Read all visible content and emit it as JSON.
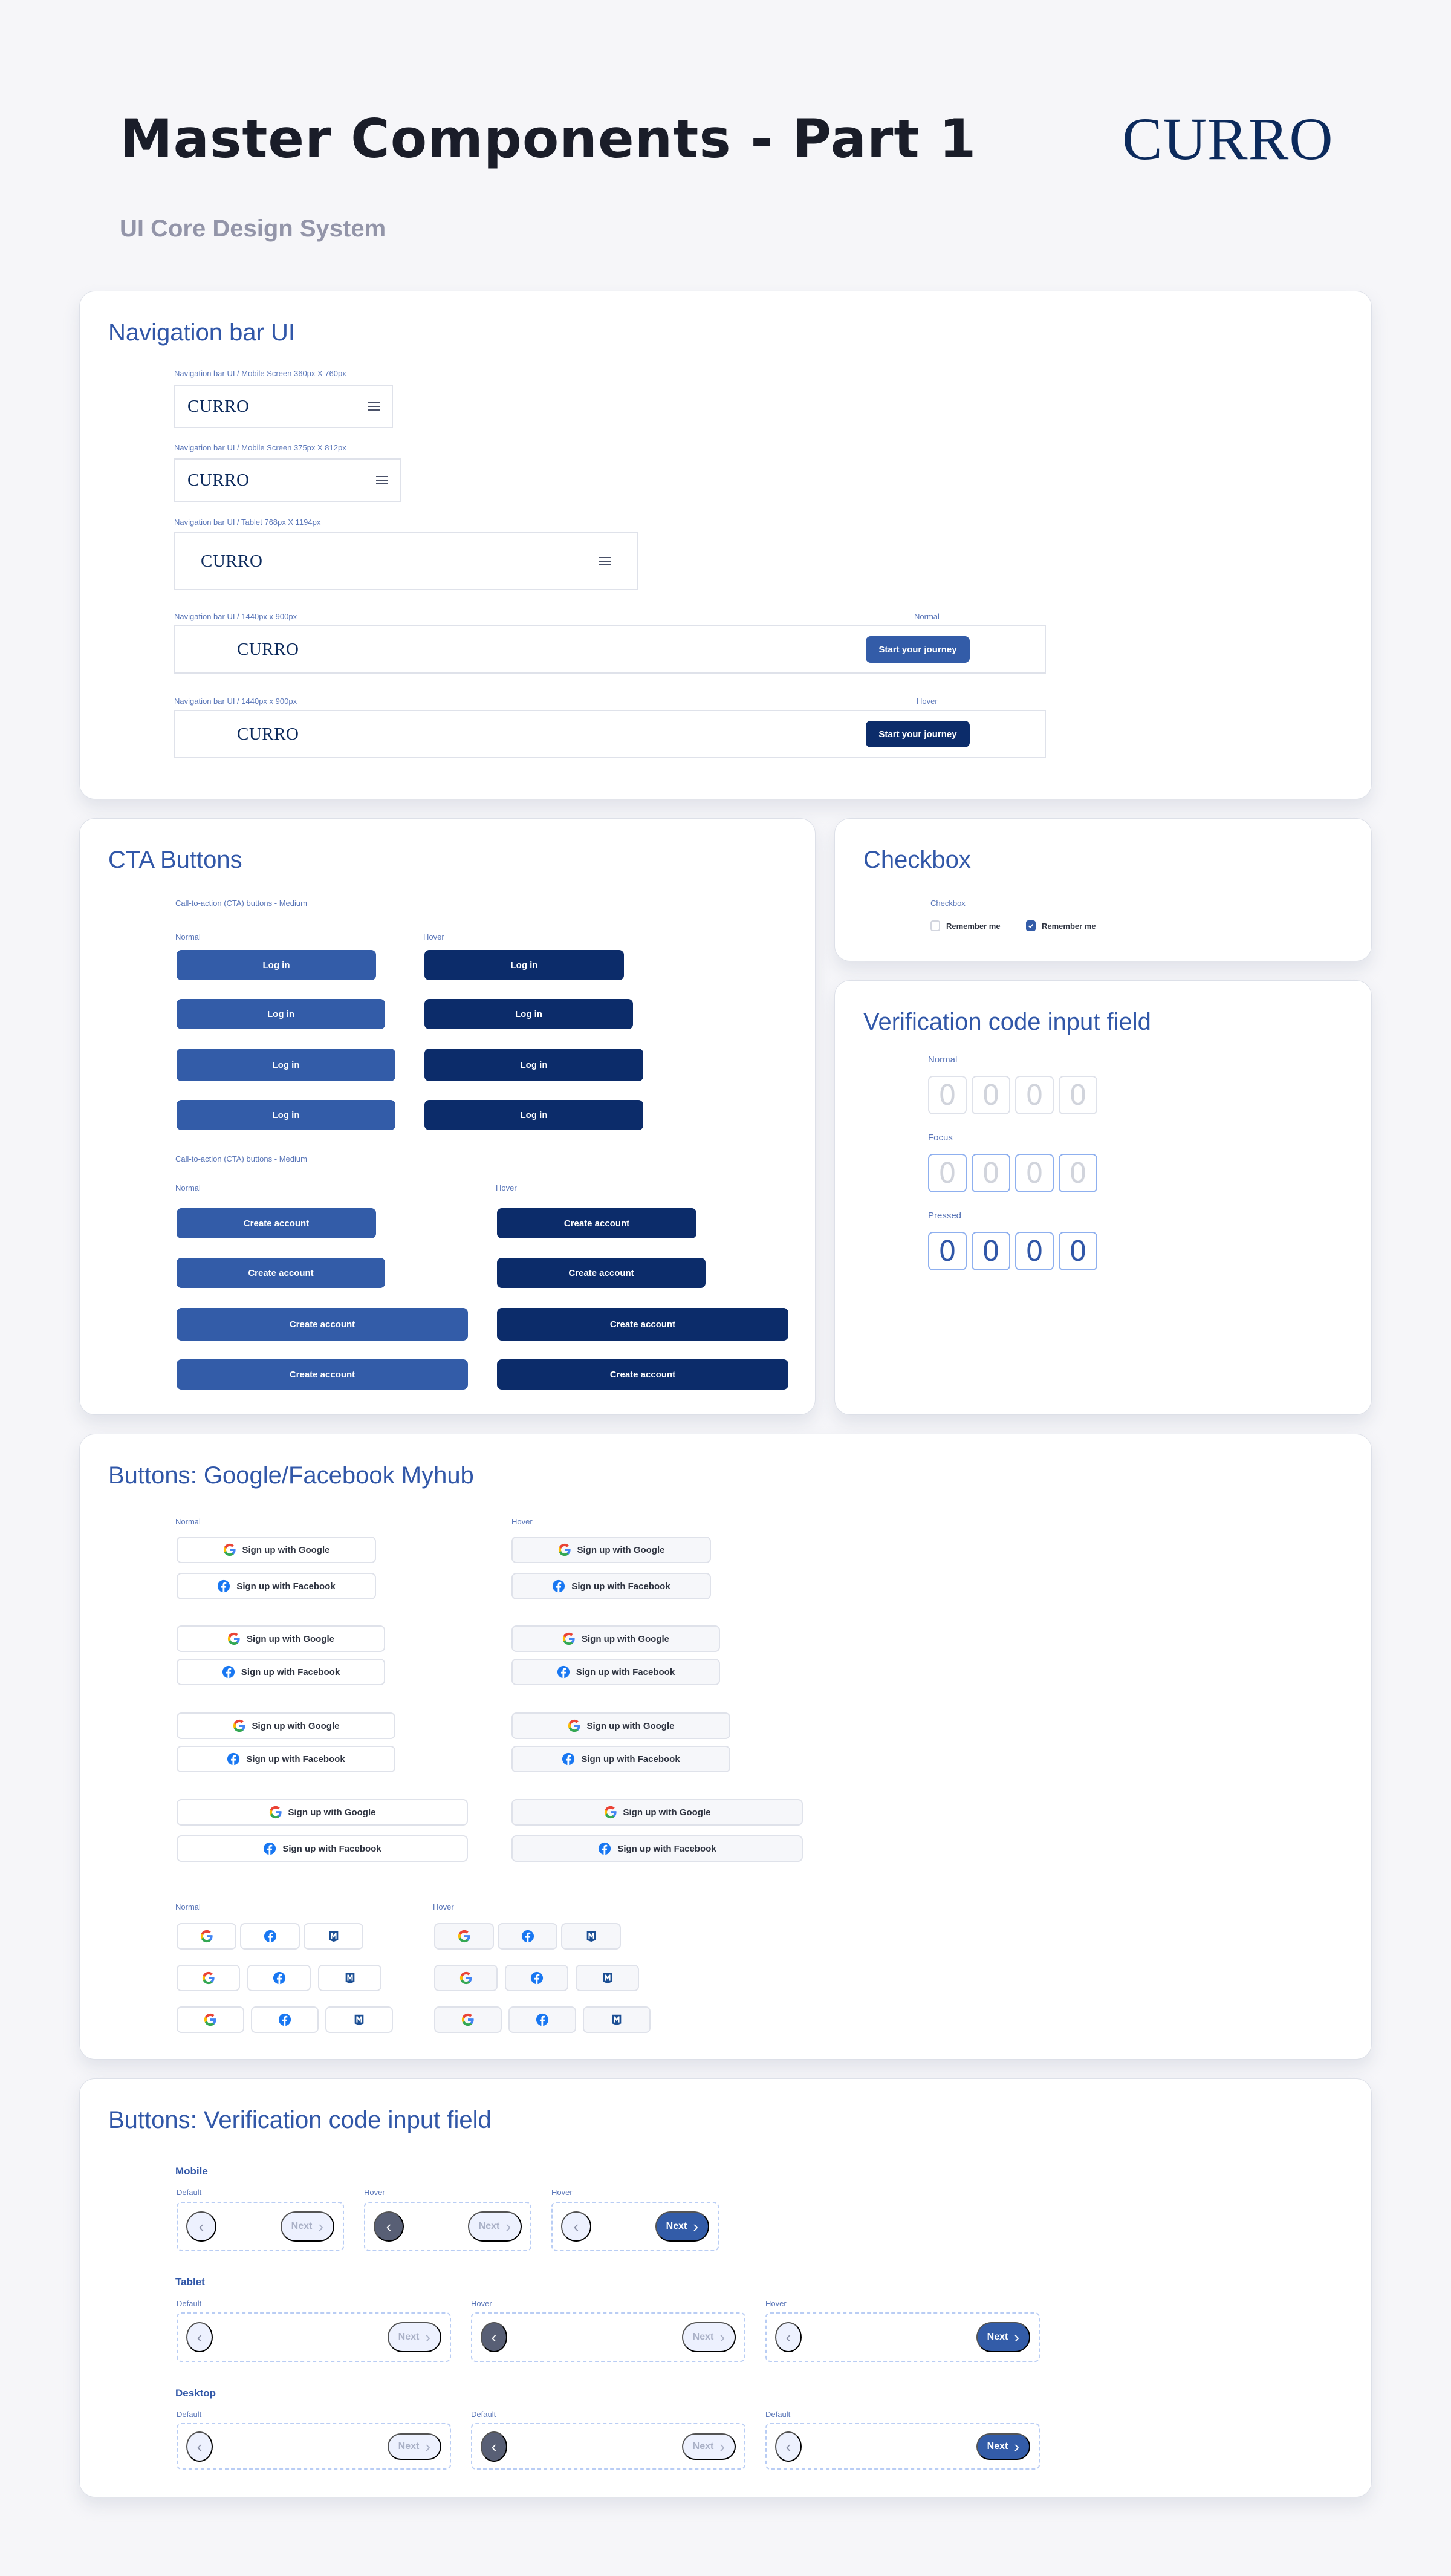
{
  "header": {
    "title": "Master Components - Part 1",
    "subtitle": "UI Core Design System",
    "logo": "CURRO"
  },
  "colors": {
    "primary": "#335ca8",
    "primary_hover": "#0c2c6a",
    "brand_navy": "#0c2a5c",
    "heading_blue": "#3157a8",
    "background": "#f6f6f9"
  },
  "navigation": {
    "title": "Navigation bar UI",
    "logo": "CURRO",
    "menu_icon": "hamburger-icon",
    "variants": [
      {
        "label": "Navigation bar UI / Mobile Screen 360px X 760px"
      },
      {
        "label": "Navigation bar UI / Mobile Screen 375px X 812px"
      },
      {
        "label": "Navigation bar UI / Tablet 768px X 1194px"
      },
      {
        "label": "Navigation bar UI / 1440px x 900px",
        "state": "Normal",
        "button": "Start your journey"
      },
      {
        "label": "Navigation bar UI / 1440px x 900px",
        "state": "Hover",
        "button": "Start your journey"
      }
    ]
  },
  "cta": {
    "title": "CTA Buttons",
    "group1_label": "Call-to-action (CTA) buttons - Medium",
    "group2_label": "Call-to-action (CTA) buttons - Medium",
    "normal": "Normal",
    "hover": "Hover",
    "login": "Log in",
    "create": "Create account"
  },
  "checkbox": {
    "title": "Checkbox",
    "label": "Checkbox",
    "items": [
      {
        "text": "Remember me",
        "checked": false
      },
      {
        "text": "Remember me",
        "checked": true
      }
    ]
  },
  "otp": {
    "title": "Verification code input field",
    "states": [
      {
        "label": "Normal",
        "digits": [
          "0",
          "0",
          "0",
          "0"
        ]
      },
      {
        "label": "Focus",
        "digits": [
          "0",
          "0",
          "0",
          "0"
        ]
      },
      {
        "label": "Pressed",
        "digits": [
          "0",
          "0",
          "0",
          "0"
        ]
      }
    ]
  },
  "social": {
    "title": "Buttons: Google/Facebook Myhub",
    "normal": "Normal",
    "hover": "Hover",
    "google": "Sign up with Google",
    "facebook": "Sign up with Facebook",
    "icons": [
      "google-icon",
      "facebook-icon",
      "myhub-icon"
    ]
  },
  "pager": {
    "title": "Buttons: Verification code input field",
    "next": "Next",
    "groups": [
      {
        "name": "Mobile",
        "states": [
          "Default",
          "Hover",
          "Hover"
        ]
      },
      {
        "name": "Tablet",
        "states": [
          "Default",
          "Hover",
          "Hover"
        ]
      },
      {
        "name": "Desktop",
        "states": [
          "Default",
          "Default",
          "Default"
        ]
      }
    ]
  }
}
